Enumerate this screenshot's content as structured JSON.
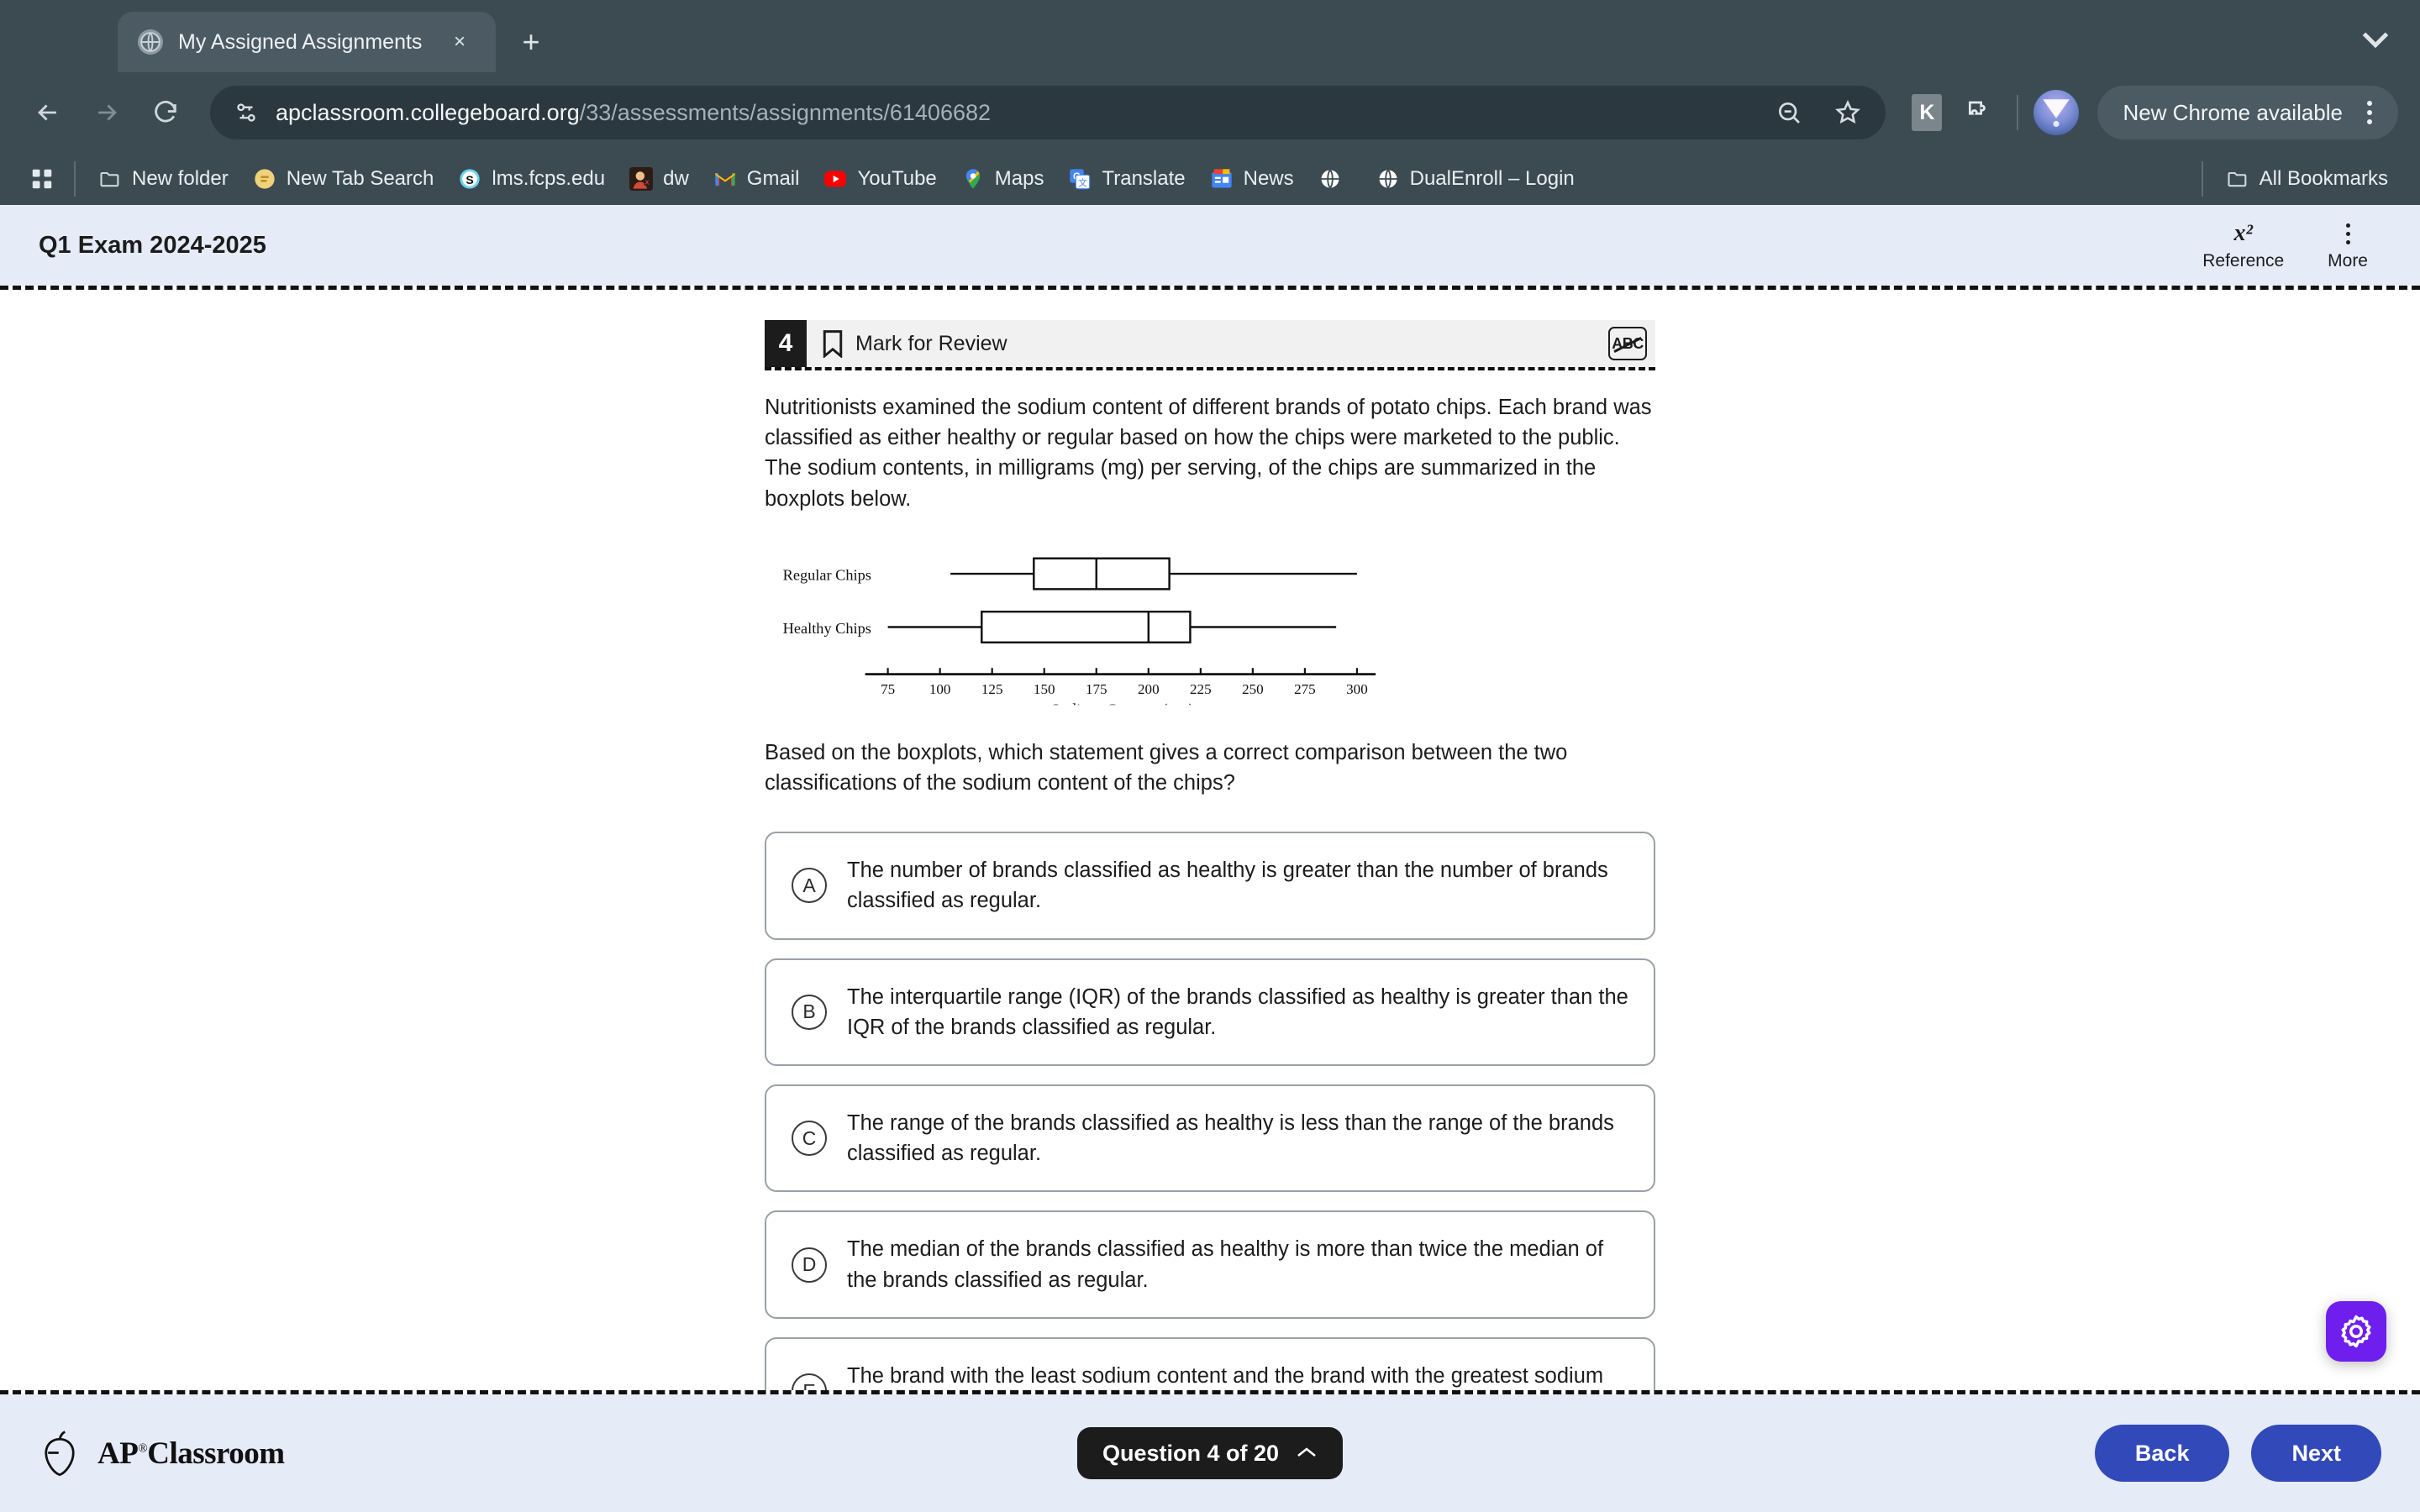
{
  "browser": {
    "tab": {
      "title": "My Assigned Assignments",
      "favicon": "globe-icon",
      "close": "×"
    },
    "new_tab_label": "+",
    "url": {
      "domain": "apclassroom.collegeboard.org",
      "path": "/33/assessments/assignments/61406682"
    },
    "update_button": "New Chrome available",
    "extension_badge": "K",
    "bookmarks": [
      {
        "label": "New folder",
        "icon": "folder-icon"
      },
      {
        "label": "New Tab Search",
        "icon": "search-extension-icon"
      },
      {
        "label": "lms.fcps.edu",
        "icon": "schoology-icon"
      },
      {
        "label": "dw",
        "icon": "game-icon"
      },
      {
        "label": "Gmail",
        "icon": "gmail-icon"
      },
      {
        "label": "YouTube",
        "icon": "youtube-icon"
      },
      {
        "label": "Maps",
        "icon": "maps-icon"
      },
      {
        "label": "Translate",
        "icon": "translate-icon"
      },
      {
        "label": "News",
        "icon": "news-icon"
      },
      {
        "label": "",
        "icon": "globe-icon"
      },
      {
        "label": "DualEnroll – Login",
        "icon": "globe-icon"
      }
    ],
    "all_bookmarks": "All Bookmarks"
  },
  "exam": {
    "title": "Q1 Exam 2024-2025",
    "reference_glyph": "x²",
    "reference_label": "Reference",
    "more_label": "More"
  },
  "question": {
    "number": "4",
    "mark_for_review": "Mark for Review",
    "crossout_tool": "ABC",
    "stem": "Nutritionists examined the sodium content of different brands of potato chips. Each brand was classified as either healthy or regular based on how the chips were marketed to the public. The sodium contents, in milligrams (mg) per serving, of the chips are summarized in the boxplots below.",
    "prompt": "Based on the boxplots, which statement gives a correct comparison between the two classifications of the sodium content of the chips?",
    "choices": [
      {
        "letter": "A",
        "text": "The number of brands classified as healthy is greater than the number of brands classified as regular."
      },
      {
        "letter": "B",
        "text": "The interquartile range (IQR) of the brands classified as healthy is greater than the IQR of the brands classified as regular."
      },
      {
        "letter": "C",
        "text": "The range of the brands classified as healthy is less than the range of the brands classified as regular."
      },
      {
        "letter": "D",
        "text": "The median of the brands classified as healthy is more than twice the median of the brands classified as regular."
      },
      {
        "letter": "E",
        "text": "The brand with the least sodium content and the brand with the greatest sodium content are both classified as healthy."
      }
    ]
  },
  "chart_data": {
    "type": "boxplot",
    "title": "",
    "xlabel": "Sodium Content (mg)",
    "ylabel": "",
    "xlim": [
      70,
      305
    ],
    "ticks": [
      75,
      100,
      125,
      150,
      175,
      200,
      225,
      250,
      275,
      300
    ],
    "grid": false,
    "legend": "none",
    "categories": [
      "Regular Chips",
      "Healthy Chips"
    ],
    "series": [
      {
        "name": "Regular Chips",
        "min": 105,
        "q1": 145,
        "median": 175,
        "q3": 210,
        "max": 300
      },
      {
        "name": "Healthy Chips",
        "min": 75,
        "q1": 120,
        "median": 200,
        "q3": 220,
        "max": 290
      }
    ]
  },
  "footer": {
    "brand": "AP",
    "brand_reg": "®",
    "brand_suffix": "Classroom",
    "question_pill": "Question 4 of 20",
    "chevron": "chevron-up-icon",
    "back": "Back",
    "next": "Next"
  },
  "fab": {
    "name": "settings-gear-icon",
    "color": "#6e1fee"
  }
}
